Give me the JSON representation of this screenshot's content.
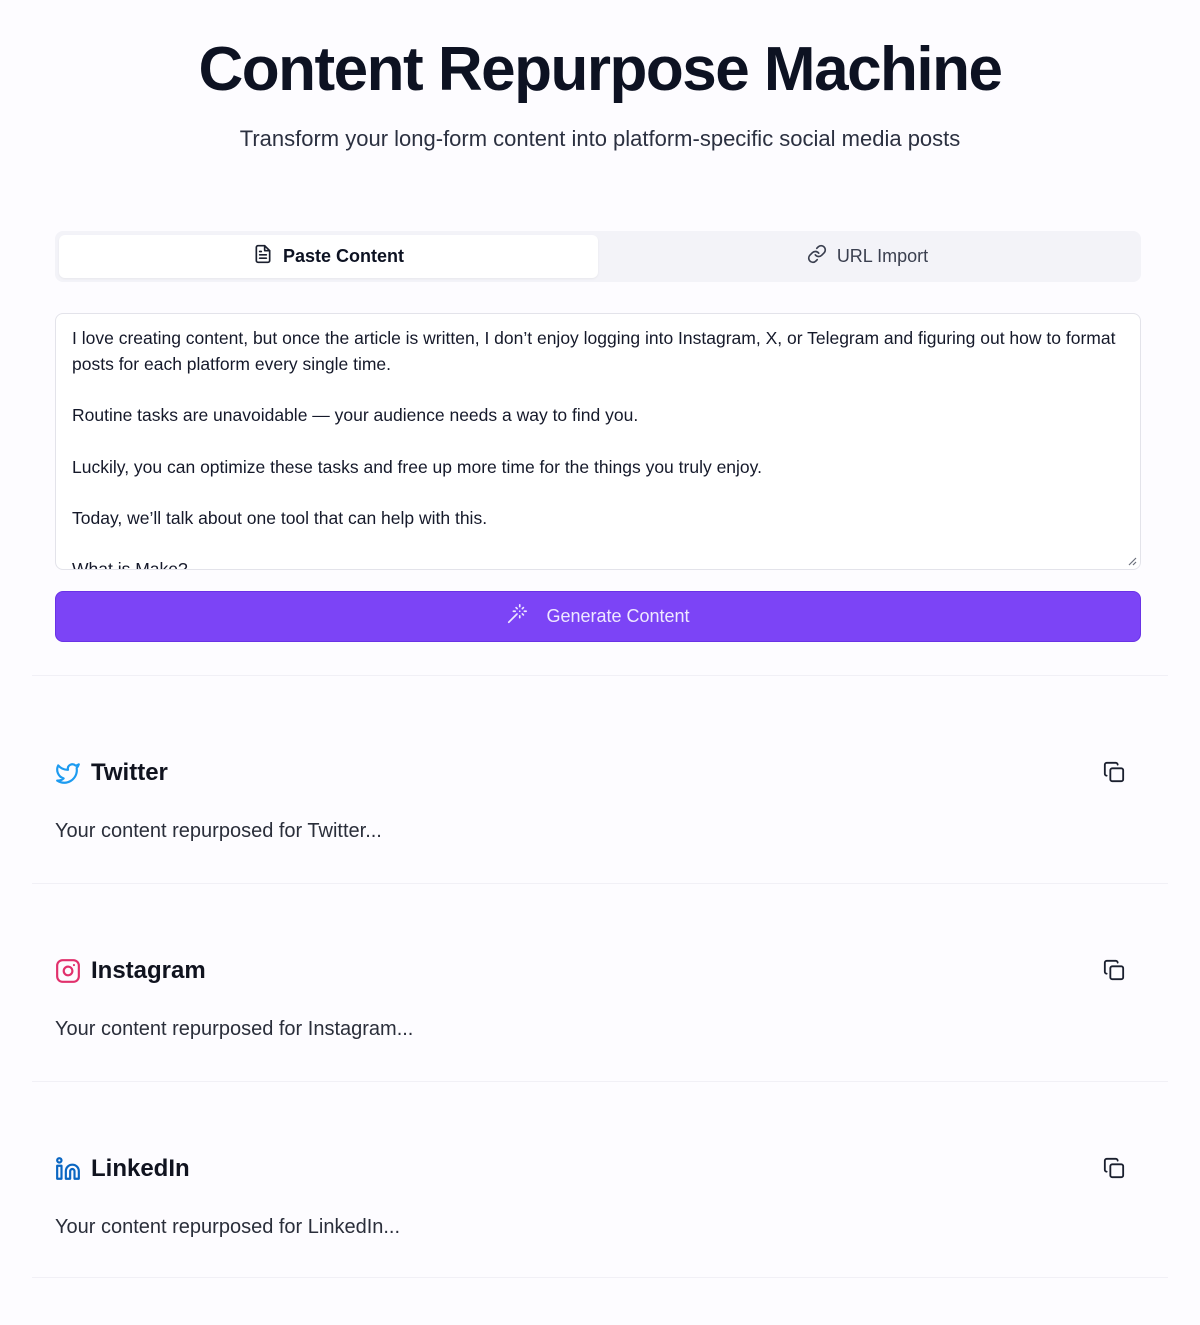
{
  "header": {
    "title": "Content Repurpose Machine",
    "subtitle": "Transform your long-form content into platform-specific social media posts"
  },
  "tabs": [
    {
      "label": "Paste Content",
      "icon": "document-icon",
      "active": true
    },
    {
      "label": "URL Import",
      "icon": "link-icon",
      "active": false
    }
  ],
  "input": {
    "value": "I love creating content, but once the article is written, I don’t enjoy logging into Instagram, X, or Telegram and figuring out how to format posts for each platform every single time.\n\nRoutine tasks are unavoidable — your audience needs a way to find you.\n\nLuckily, you can optimize these tasks and free up more time for the things you truly enjoy.\n\nToday, we’ll talk about one tool that can help with this.\n\nWhat is Make?"
  },
  "generate_button": {
    "label": "Generate Content",
    "icon": "magic-wand-icon",
    "color": "#7c44f6"
  },
  "platforms": [
    {
      "name": "Twitter",
      "icon": "twitter-icon",
      "color": "#1d9bf0",
      "output": "Your content repurposed for Twitter..."
    },
    {
      "name": "Instagram",
      "icon": "instagram-icon",
      "color": "#e1306c",
      "output": "Your content repurposed for Instagram..."
    },
    {
      "name": "LinkedIn",
      "icon": "linkedin-icon",
      "color": "#0a66c2",
      "output": "Your content repurposed for LinkedIn..."
    }
  ]
}
